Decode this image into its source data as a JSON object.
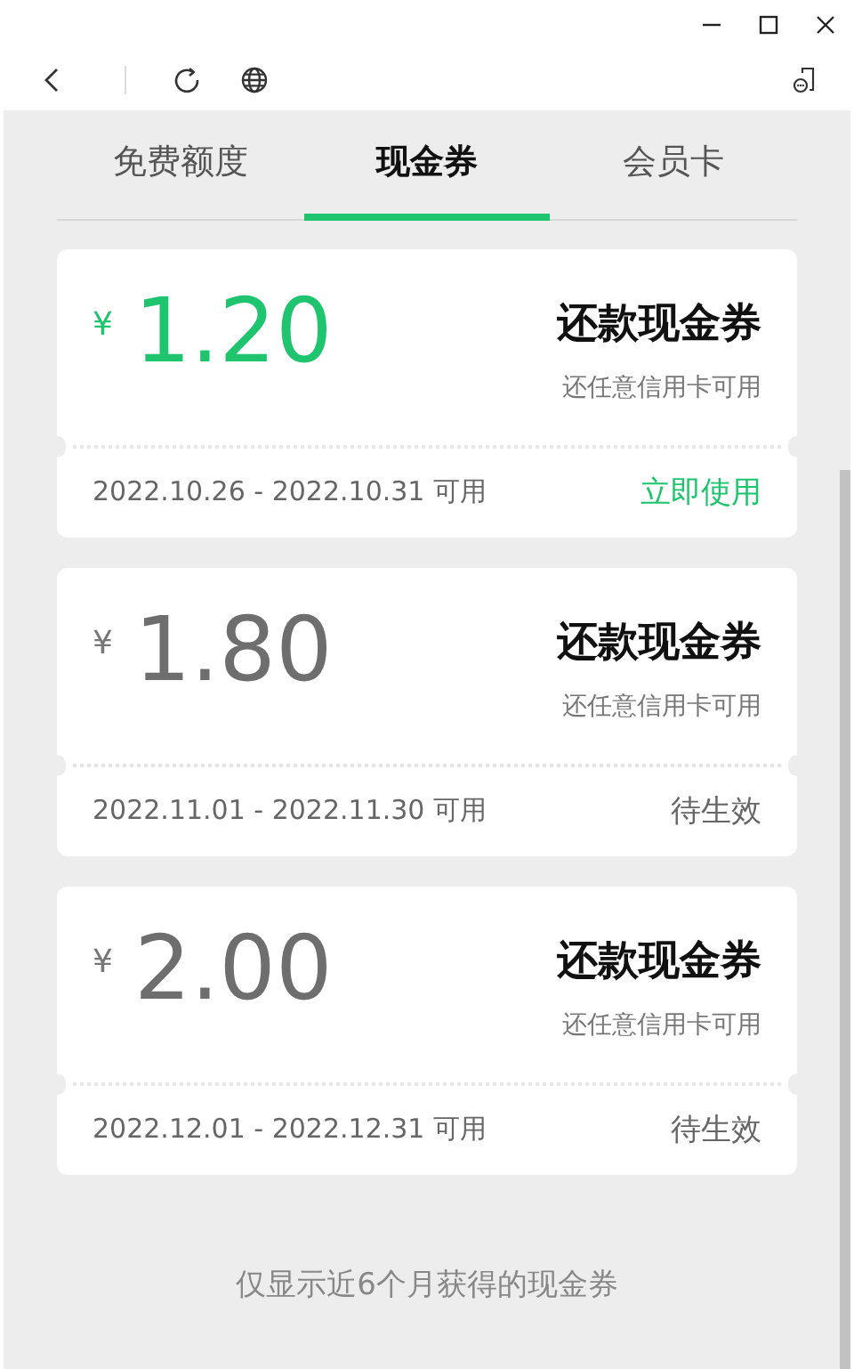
{
  "tabs": [
    {
      "label": "免费额度",
      "selected": false
    },
    {
      "label": "现金券",
      "selected": true
    },
    {
      "label": "会员卡",
      "selected": false
    }
  ],
  "coupons": [
    {
      "currency": "¥",
      "amount": "1.20",
      "title": "还款现金券",
      "note": "还任意信用卡可用",
      "validity": "2022.10.26 - 2022.10.31 可用",
      "action": "立即使用",
      "usable": true
    },
    {
      "currency": "¥",
      "amount": "1.80",
      "title": "还款现金券",
      "note": "还任意信用卡可用",
      "validity": "2022.11.01 - 2022.11.30 可用",
      "action": "待生效",
      "usable": false
    },
    {
      "currency": "¥",
      "amount": "2.00",
      "title": "还款现金券",
      "note": "还任意信用卡可用",
      "validity": "2022.12.01 - 2022.12.31 可用",
      "action": "待生效",
      "usable": false
    }
  ],
  "footer_note": "仅显示近6个月获得的现金券"
}
